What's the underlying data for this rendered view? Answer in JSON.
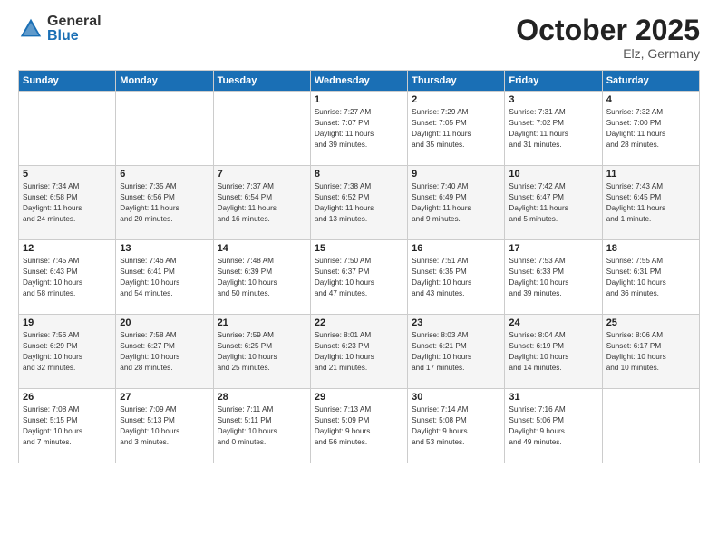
{
  "header": {
    "logo_general": "General",
    "logo_blue": "Blue",
    "month_title": "October 2025",
    "location": "Elz, Germany"
  },
  "days_of_week": [
    "Sunday",
    "Monday",
    "Tuesday",
    "Wednesday",
    "Thursday",
    "Friday",
    "Saturday"
  ],
  "weeks": [
    [
      {
        "day": "",
        "info": ""
      },
      {
        "day": "",
        "info": ""
      },
      {
        "day": "",
        "info": ""
      },
      {
        "day": "1",
        "info": "Sunrise: 7:27 AM\nSunset: 7:07 PM\nDaylight: 11 hours\nand 39 minutes."
      },
      {
        "day": "2",
        "info": "Sunrise: 7:29 AM\nSunset: 7:05 PM\nDaylight: 11 hours\nand 35 minutes."
      },
      {
        "day": "3",
        "info": "Sunrise: 7:31 AM\nSunset: 7:02 PM\nDaylight: 11 hours\nand 31 minutes."
      },
      {
        "day": "4",
        "info": "Sunrise: 7:32 AM\nSunset: 7:00 PM\nDaylight: 11 hours\nand 28 minutes."
      }
    ],
    [
      {
        "day": "5",
        "info": "Sunrise: 7:34 AM\nSunset: 6:58 PM\nDaylight: 11 hours\nand 24 minutes."
      },
      {
        "day": "6",
        "info": "Sunrise: 7:35 AM\nSunset: 6:56 PM\nDaylight: 11 hours\nand 20 minutes."
      },
      {
        "day": "7",
        "info": "Sunrise: 7:37 AM\nSunset: 6:54 PM\nDaylight: 11 hours\nand 16 minutes."
      },
      {
        "day": "8",
        "info": "Sunrise: 7:38 AM\nSunset: 6:52 PM\nDaylight: 11 hours\nand 13 minutes."
      },
      {
        "day": "9",
        "info": "Sunrise: 7:40 AM\nSunset: 6:49 PM\nDaylight: 11 hours\nand 9 minutes."
      },
      {
        "day": "10",
        "info": "Sunrise: 7:42 AM\nSunset: 6:47 PM\nDaylight: 11 hours\nand 5 minutes."
      },
      {
        "day": "11",
        "info": "Sunrise: 7:43 AM\nSunset: 6:45 PM\nDaylight: 11 hours\nand 1 minute."
      }
    ],
    [
      {
        "day": "12",
        "info": "Sunrise: 7:45 AM\nSunset: 6:43 PM\nDaylight: 10 hours\nand 58 minutes."
      },
      {
        "day": "13",
        "info": "Sunrise: 7:46 AM\nSunset: 6:41 PM\nDaylight: 10 hours\nand 54 minutes."
      },
      {
        "day": "14",
        "info": "Sunrise: 7:48 AM\nSunset: 6:39 PM\nDaylight: 10 hours\nand 50 minutes."
      },
      {
        "day": "15",
        "info": "Sunrise: 7:50 AM\nSunset: 6:37 PM\nDaylight: 10 hours\nand 47 minutes."
      },
      {
        "day": "16",
        "info": "Sunrise: 7:51 AM\nSunset: 6:35 PM\nDaylight: 10 hours\nand 43 minutes."
      },
      {
        "day": "17",
        "info": "Sunrise: 7:53 AM\nSunset: 6:33 PM\nDaylight: 10 hours\nand 39 minutes."
      },
      {
        "day": "18",
        "info": "Sunrise: 7:55 AM\nSunset: 6:31 PM\nDaylight: 10 hours\nand 36 minutes."
      }
    ],
    [
      {
        "day": "19",
        "info": "Sunrise: 7:56 AM\nSunset: 6:29 PM\nDaylight: 10 hours\nand 32 minutes."
      },
      {
        "day": "20",
        "info": "Sunrise: 7:58 AM\nSunset: 6:27 PM\nDaylight: 10 hours\nand 28 minutes."
      },
      {
        "day": "21",
        "info": "Sunrise: 7:59 AM\nSunset: 6:25 PM\nDaylight: 10 hours\nand 25 minutes."
      },
      {
        "day": "22",
        "info": "Sunrise: 8:01 AM\nSunset: 6:23 PM\nDaylight: 10 hours\nand 21 minutes."
      },
      {
        "day": "23",
        "info": "Sunrise: 8:03 AM\nSunset: 6:21 PM\nDaylight: 10 hours\nand 17 minutes."
      },
      {
        "day": "24",
        "info": "Sunrise: 8:04 AM\nSunset: 6:19 PM\nDaylight: 10 hours\nand 14 minutes."
      },
      {
        "day": "25",
        "info": "Sunrise: 8:06 AM\nSunset: 6:17 PM\nDaylight: 10 hours\nand 10 minutes."
      }
    ],
    [
      {
        "day": "26",
        "info": "Sunrise: 7:08 AM\nSunset: 5:15 PM\nDaylight: 10 hours\nand 7 minutes."
      },
      {
        "day": "27",
        "info": "Sunrise: 7:09 AM\nSunset: 5:13 PM\nDaylight: 10 hours\nand 3 minutes."
      },
      {
        "day": "28",
        "info": "Sunrise: 7:11 AM\nSunset: 5:11 PM\nDaylight: 10 hours\nand 0 minutes."
      },
      {
        "day": "29",
        "info": "Sunrise: 7:13 AM\nSunset: 5:09 PM\nDaylight: 9 hours\nand 56 minutes."
      },
      {
        "day": "30",
        "info": "Sunrise: 7:14 AM\nSunset: 5:08 PM\nDaylight: 9 hours\nand 53 minutes."
      },
      {
        "day": "31",
        "info": "Sunrise: 7:16 AM\nSunset: 5:06 PM\nDaylight: 9 hours\nand 49 minutes."
      },
      {
        "day": "",
        "info": ""
      }
    ]
  ]
}
